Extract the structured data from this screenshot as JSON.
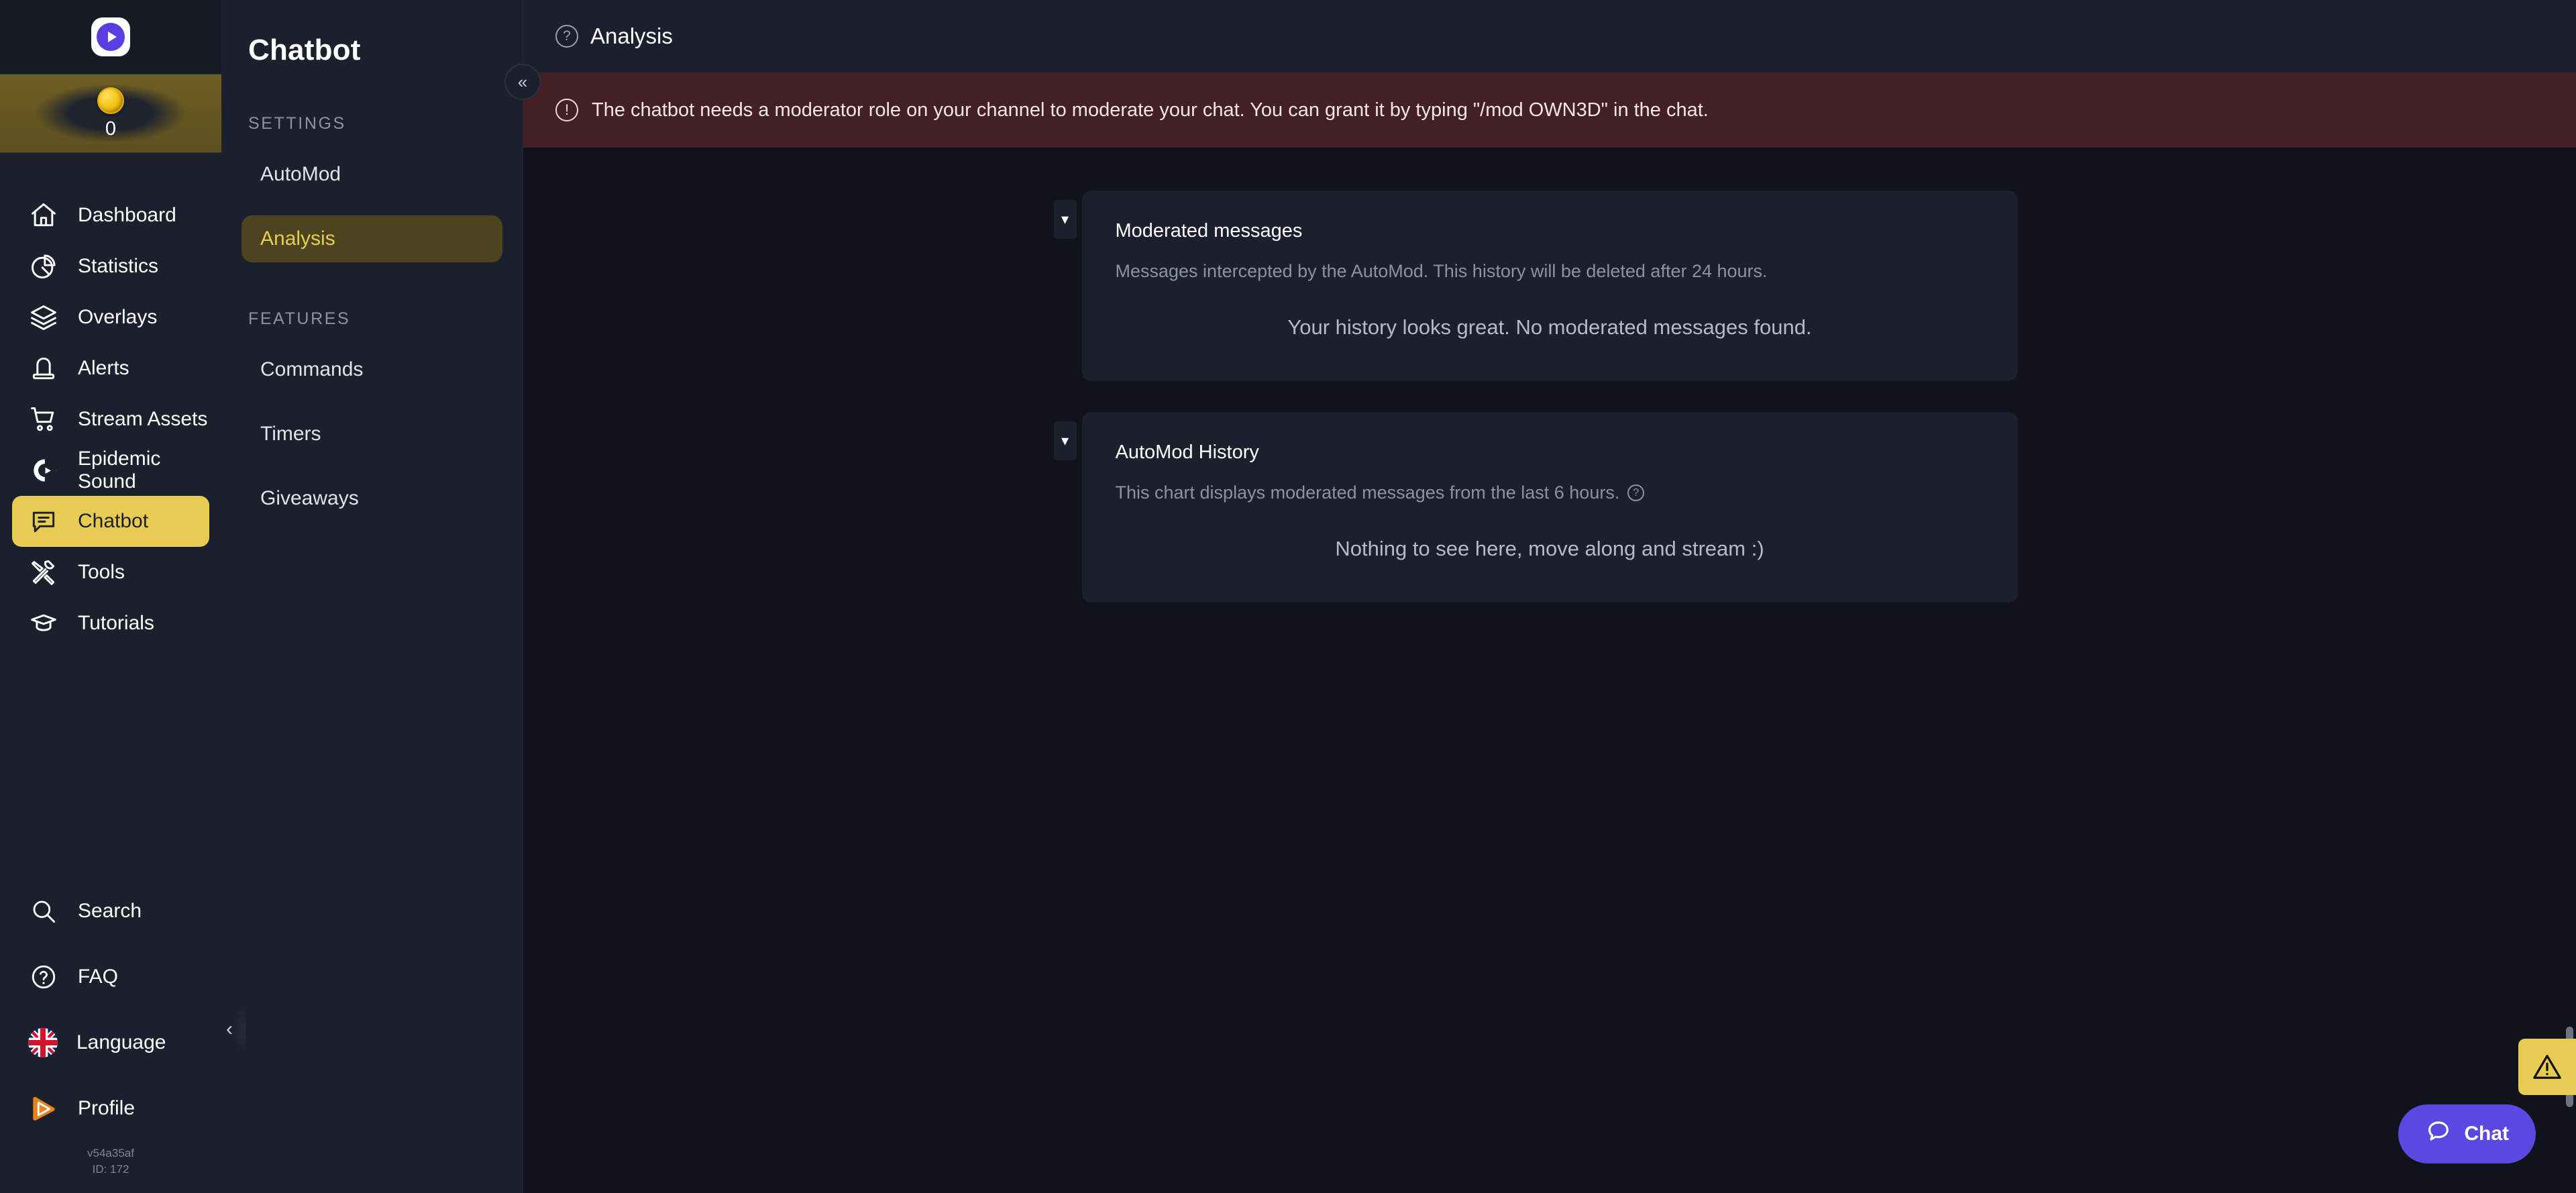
{
  "rail": {
    "logo_icon": "own3d-play-logo-icon",
    "coin": {
      "icon": "coin-icon",
      "count": "0"
    },
    "items": [
      {
        "label": "Dashboard",
        "icon": "home-icon",
        "active": false
      },
      {
        "label": "Statistics",
        "icon": "pie-chart-icon",
        "active": false
      },
      {
        "label": "Overlays",
        "icon": "layers-icon",
        "active": false
      },
      {
        "label": "Alerts",
        "icon": "alert-light-icon",
        "active": false
      },
      {
        "label": "Stream Assets",
        "icon": "shopping-cart-icon",
        "active": false
      },
      {
        "label": "Epidemic Sound",
        "icon": "epidemic-sound-icon",
        "active": false
      },
      {
        "label": "Chatbot",
        "icon": "chat-bubble-icon",
        "active": true
      },
      {
        "label": "Tools",
        "icon": "tools-icon",
        "active": false
      },
      {
        "label": "Tutorials",
        "icon": "graduation-cap-icon",
        "active": false
      }
    ],
    "bottom_items": [
      {
        "label": "Search",
        "icon": "search-icon"
      },
      {
        "label": "FAQ",
        "icon": "question-circle-icon"
      },
      {
        "label": "Language",
        "icon": "uk-flag-icon"
      },
      {
        "label": "Profile",
        "icon": "profile-play-icon"
      }
    ],
    "version": "v54a35af",
    "user_id": "ID: 172"
  },
  "panel": {
    "title": "Chatbot",
    "collapse_icon": "chevron-double-left-icon",
    "edge_handle_icon": "chevron-left-icon",
    "groups": [
      {
        "label": "SETTINGS",
        "items": [
          {
            "label": "AutoMod",
            "active": false
          },
          {
            "label": "Analysis",
            "active": true
          }
        ]
      },
      {
        "label": "FEATURES",
        "items": [
          {
            "label": "Commands",
            "active": false
          },
          {
            "label": "Timers",
            "active": false
          },
          {
            "label": "Giveaways",
            "active": false
          }
        ]
      }
    ]
  },
  "header": {
    "help_icon": "question-circle-icon",
    "title": "Analysis"
  },
  "banner": {
    "icon": "exclamation-circle-icon",
    "text": "The chatbot needs a moderator role on your channel to moderate your chat. You can grant it by typing \"/mod OWN3D\" in the chat.",
    "background": "#432026"
  },
  "cards": [
    {
      "caret_icon": "caret-down-icon",
      "title": "Moderated messages",
      "subtitle": "Messages intercepted by the AutoMod. This history will be deleted after 24 hours.",
      "has_info_icon": false,
      "empty_text": "Your history looks great. No moderated messages found."
    },
    {
      "caret_icon": "caret-down-icon",
      "title": "AutoMod History",
      "subtitle": "This chart displays moderated messages from the last 6 hours.",
      "has_info_icon": true,
      "empty_text": "Nothing to see here, move along and stream :)"
    }
  ],
  "floating": {
    "warning_tab_icon": "warning-triangle-icon",
    "chat_button": {
      "icon": "chat-bubble-icon",
      "label": "Chat"
    }
  },
  "colors": {
    "accent_yellow": "#e8cb52",
    "panel_bg": "#1b202c",
    "main_bg": "#10131b",
    "banner_bg": "#432026",
    "chat_purple": "#5b48e0"
  }
}
